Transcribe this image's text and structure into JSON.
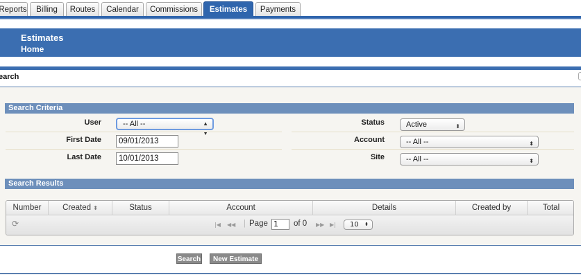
{
  "tabs": [
    "Reports",
    "Billing",
    "Routes",
    "Calendar",
    "Commissions",
    "Estimates",
    "Payments"
  ],
  "active_tab": "Estimates",
  "header": {
    "title": "Estimates",
    "subtitle": "Home"
  },
  "search_title": "earch",
  "criteria": {
    "section_label": "Search Criteria",
    "user_label": "User",
    "user_value": "-- All --",
    "first_date_label": "First Date",
    "first_date_value": "09/01/2013",
    "last_date_label": "Last Date",
    "last_date_value": "10/01/2013",
    "status_label": "Status",
    "status_value": "Active",
    "account_label": "Account",
    "account_value": "-- All --",
    "site_label": "Site",
    "site_value": "-- All --"
  },
  "results": {
    "section_label": "Search Results",
    "columns": [
      "Number",
      "Created",
      "Status",
      "Account",
      "Details",
      "Created by",
      "Total"
    ],
    "pager": {
      "page_label": "Page",
      "page_value": "1",
      "of_label": "of 0",
      "page_size": "10"
    }
  },
  "buttons": {
    "search": "Search",
    "new_estimate": "New Estimate"
  },
  "colors": {
    "brand_blue": "#3b6eb1",
    "section_blue": "#6d8fbb",
    "panel_bg": "#f6f5f1"
  }
}
